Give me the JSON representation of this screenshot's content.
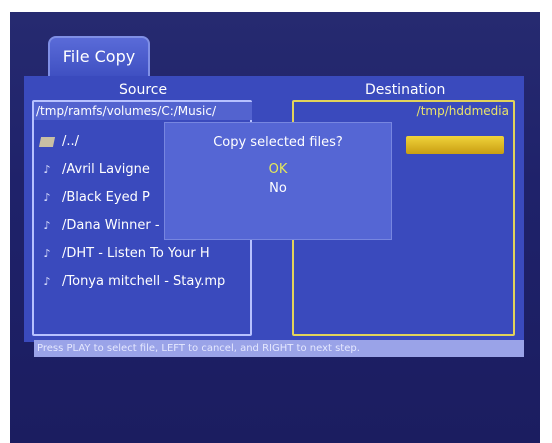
{
  "window": {
    "title": "File Copy"
  },
  "source": {
    "label": "Source",
    "path": "/tmp/ramfs/volumes/C:/Music/",
    "items": [
      {
        "name": "/../",
        "icon": "folder-icon"
      },
      {
        "name": "/Avril Lavigne",
        "icon": "music-note-icon"
      },
      {
        "name": "/Black Eyed P",
        "icon": "music-note-icon"
      },
      {
        "name": "/Dana Winner - Moonl",
        "icon": "music-note-icon",
        "selected": true
      },
      {
        "name": "/DHT - Listen To Your H",
        "icon": "music-note-icon"
      },
      {
        "name": "/Tonya mitchell - Stay.mp",
        "icon": "music-note-icon"
      }
    ]
  },
  "destination": {
    "label": "Destination",
    "path": "/tmp/hddmedia"
  },
  "dialog": {
    "message": "Copy selected files?",
    "ok_label": "OK",
    "no_label": "No"
  },
  "help": {
    "text": "Press PLAY to select file, LEFT to cancel, and RIGHT to next step."
  },
  "colors": {
    "background": "#262a70",
    "panel": "#3a4abd",
    "dialog": "#5566d4",
    "highlight": "#e2c12a",
    "focus_text": "#e6e95a"
  }
}
